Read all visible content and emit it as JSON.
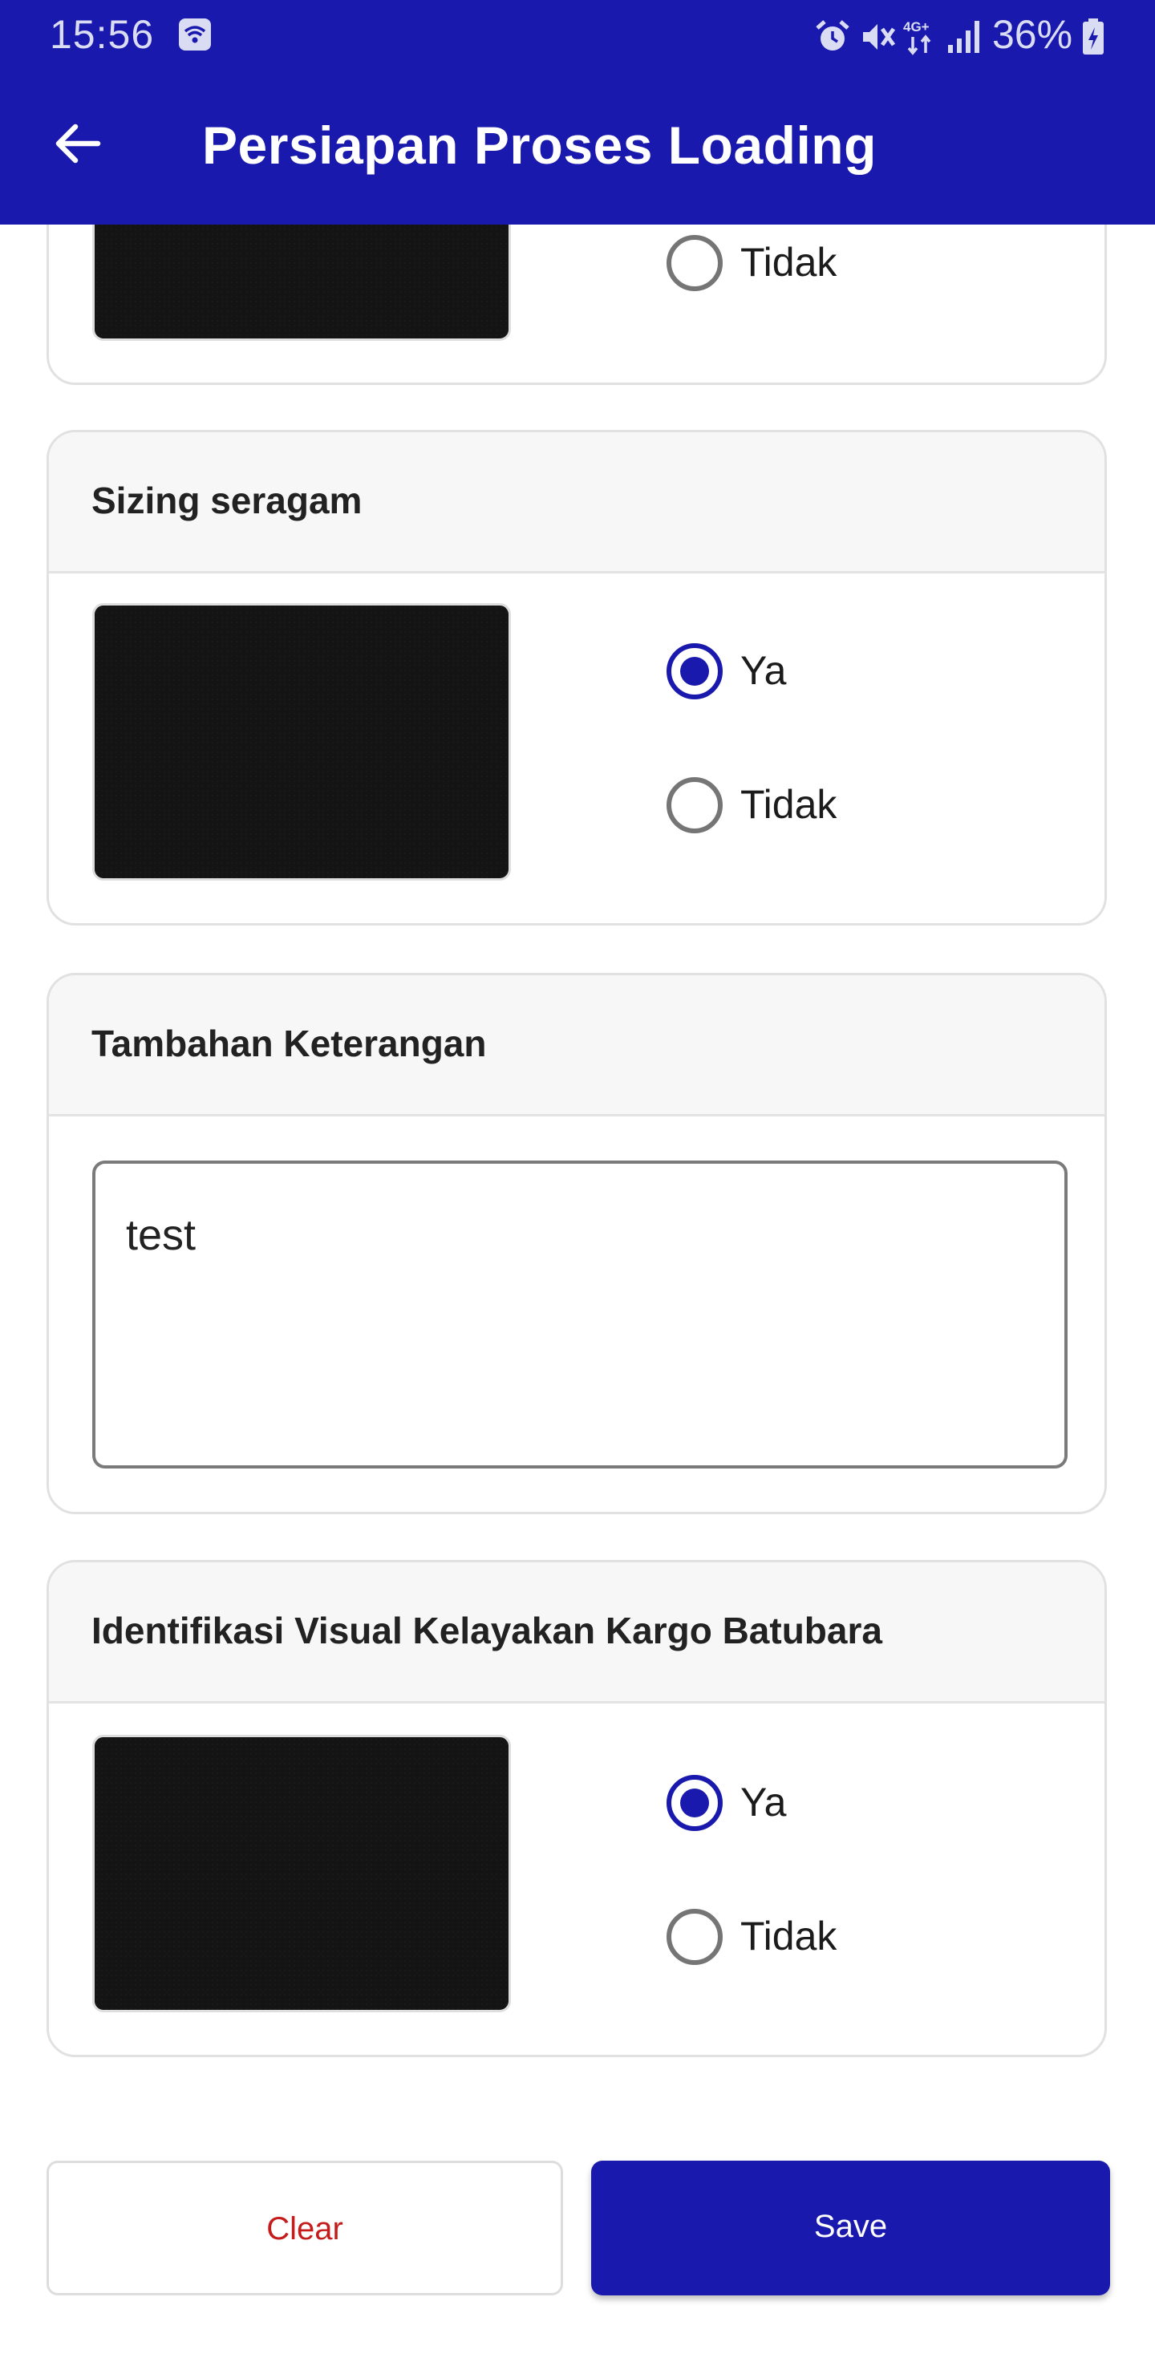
{
  "status_bar": {
    "time": "15:56",
    "network": "4G+",
    "battery": "36%",
    "icons": [
      "wifi-icon",
      "alarm-icon",
      "mute-icon",
      "network-4g-icon",
      "signal-icon",
      "battery-charging-icon"
    ]
  },
  "app_bar": {
    "title": "Persiapan Proses Loading",
    "back_icon": "arrow-left-icon",
    "color": "#1a19ad"
  },
  "cards": [
    {
      "title": "",
      "photo": "photo-thumbnail",
      "options": [
        {
          "label": "Tidak",
          "checked": false
        }
      ]
    },
    {
      "title": "Sizing seragam",
      "photo": "photo-thumbnail",
      "options": [
        {
          "label": "Ya",
          "checked": true
        },
        {
          "label": "Tidak",
          "checked": false
        }
      ]
    },
    {
      "title": "Tambahan Keterangan",
      "input_value": "test"
    },
    {
      "title": "Identifikasi Visual Kelayakan Kargo Batubara",
      "photo": "photo-thumbnail",
      "options": [
        {
          "label": "Ya",
          "checked": true
        },
        {
          "label": "Tidak",
          "checked": false
        }
      ]
    }
  ],
  "actions": {
    "clear_label": "Clear",
    "save_label": "Save",
    "clear_color": "#c61b1b",
    "save_color": "#1a19ad"
  }
}
